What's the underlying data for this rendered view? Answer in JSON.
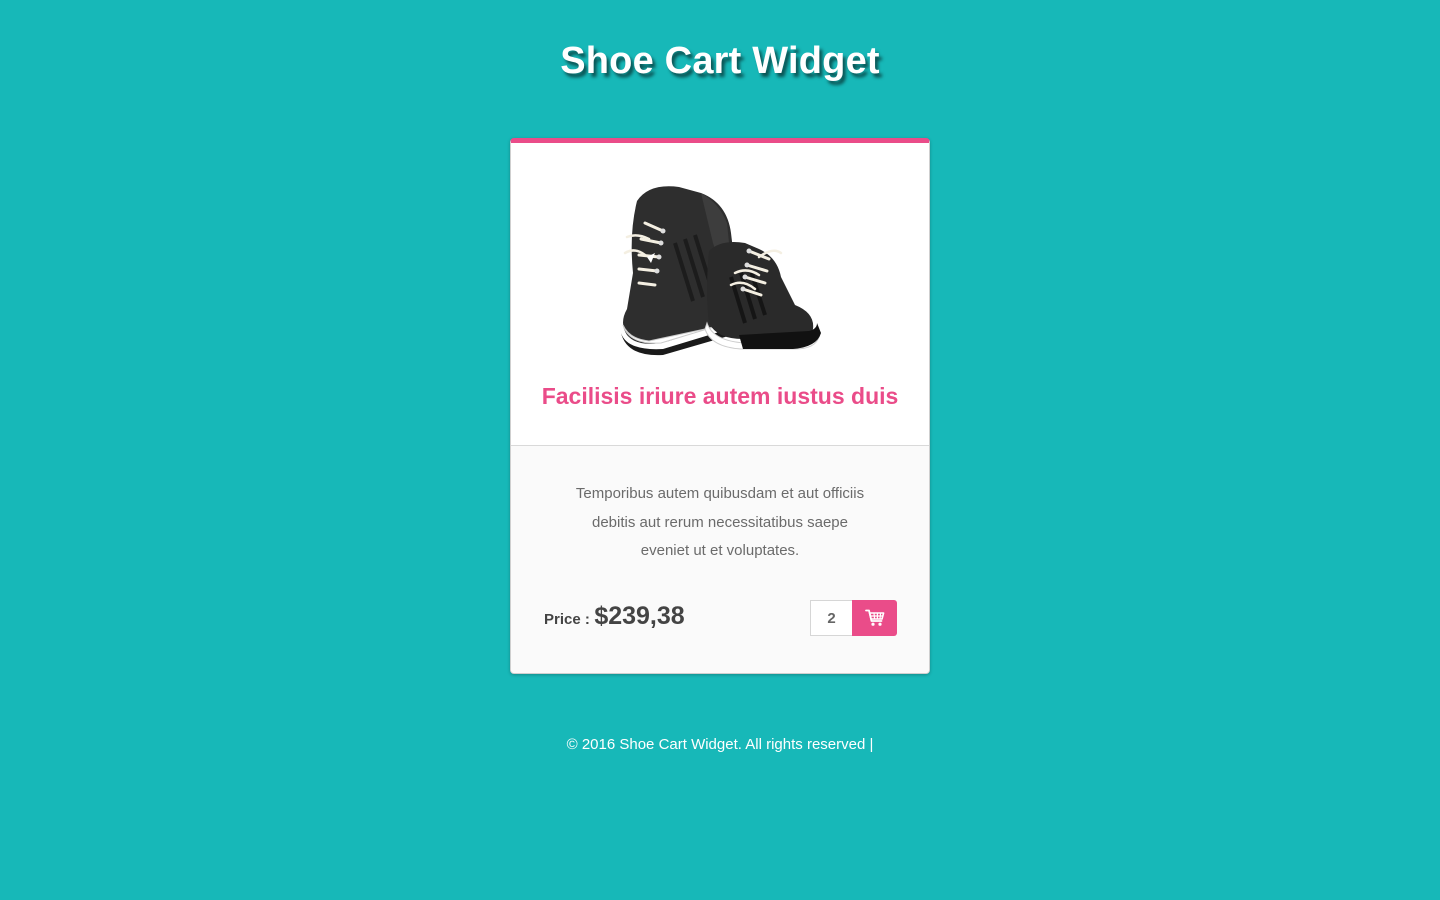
{
  "page": {
    "title": "Shoe Cart Widget",
    "background_color": "#17b8b8",
    "accent_color": "#ea4c89"
  },
  "product": {
    "image_icon": "sneakers-image",
    "title": "Facilisis iriure autem iustus duis",
    "description": "Temporibus autem quibusdam et aut officiis debitis aut rerum necessitatibus saepe eveniet ut et voluptates.",
    "price_label": "Price :",
    "price_value": "$239,38",
    "quantity": "2",
    "cart_icon": "shopping-cart-icon"
  },
  "footer": {
    "text": "© 2016 Shoe Cart Widget. All rights reserved |"
  }
}
